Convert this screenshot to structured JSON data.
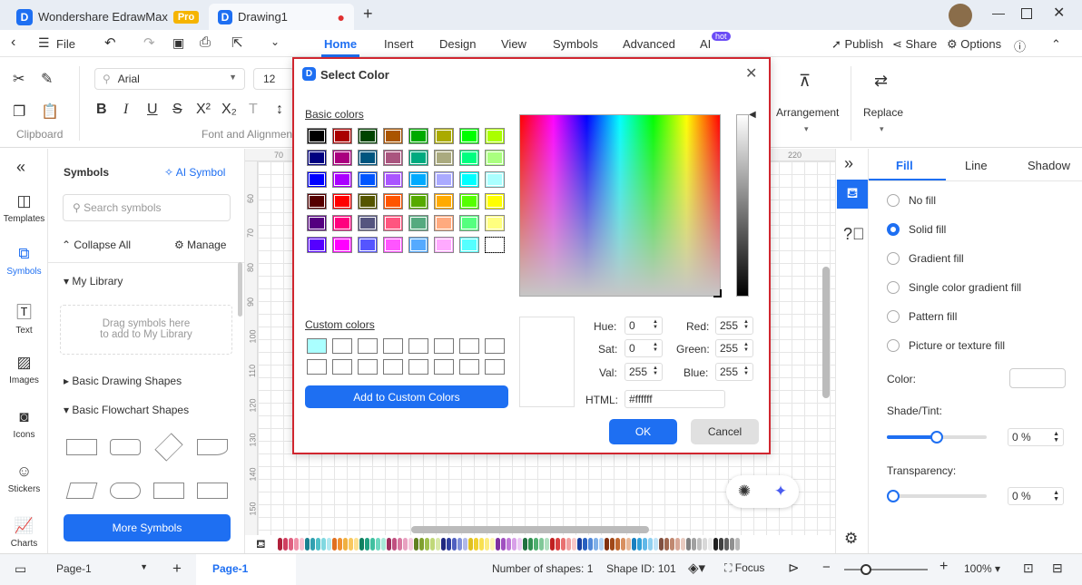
{
  "app": {
    "name": "Wondershare EdrawMax",
    "badge": "Pro",
    "doc_tab": "Drawing1"
  },
  "menu": {
    "file": "File",
    "tabs": [
      "Home",
      "Insert",
      "Design",
      "View",
      "Symbols",
      "Advanced",
      "AI"
    ],
    "ai_badge": "hot",
    "publish": "Publish",
    "share": "Share",
    "options": "Options"
  },
  "ribbon": {
    "font": "Arial",
    "size": "12",
    "clipboard": "Clipboard",
    "font_group": "Font and Alignment",
    "arrangement": "Arrangement",
    "replace": "Replace"
  },
  "leftbar": [
    "Templates",
    "Symbols",
    "Text",
    "Images",
    "Icons",
    "Stickers",
    "Charts"
  ],
  "symbols": {
    "title": "Symbols",
    "ai": "AI Symbol",
    "search_placeholder": "Search symbols",
    "collapse": "Collapse All",
    "manage": "Manage",
    "my_library": "My Library",
    "drop_hint": "Drag symbols here\nto add to My Library",
    "basic_drawing": "Basic Drawing Shapes",
    "basic_flowchart": "Basic Flowchart Shapes",
    "more": "More Symbols"
  },
  "ruler": {
    "top_first": "70",
    "top_last": "220",
    "left": [
      "60",
      "70",
      "80",
      "90",
      "100",
      "110",
      "120",
      "130",
      "140",
      "150"
    ]
  },
  "dialog": {
    "title": "Select Color",
    "basic_label": "Basic colors",
    "custom_label": "Custom colors",
    "add_custom": "Add to Custom Colors",
    "basic_colors": [
      "#000000",
      "#aa0000",
      "#004400",
      "#aa5500",
      "#00aa00",
      "#aaaa00",
      "#00ff00",
      "#aaff00",
      "#000080",
      "#aa007f",
      "#00557f",
      "#aa557f",
      "#00aa7f",
      "#aaaa7f",
      "#00ff7f",
      "#aaff7f",
      "#0000ff",
      "#aa00ff",
      "#0055ff",
      "#aa55ff",
      "#00aaff",
      "#aaaaff",
      "#00ffff",
      "#aaffff",
      "#550000",
      "#ff0000",
      "#555500",
      "#ff5500",
      "#55aa00",
      "#ffaa00",
      "#55ff00",
      "#ffff00",
      "#550080",
      "#ff007f",
      "#55557f",
      "#ff557f",
      "#55aa7f",
      "#ffaa7f",
      "#55ff7f",
      "#ffff7f",
      "#5500ff",
      "#ff00ff",
      "#5555ff",
      "#ff55ff",
      "#55aaff",
      "#ffaaff",
      "#55ffff",
      "#ffffff"
    ],
    "custom_colors": [
      "#aaffff",
      "#ffffff",
      "#ffffff",
      "#ffffff",
      "#ffffff",
      "#ffffff",
      "#ffffff",
      "#ffffff",
      "#ffffff",
      "#ffffff",
      "#ffffff",
      "#ffffff",
      "#ffffff",
      "#ffffff",
      "#ffffff",
      "#ffffff"
    ],
    "hue_label": "Hue:",
    "hue": "0",
    "sat_label": "Sat:",
    "sat": "0",
    "val_label": "Val:",
    "val": "255",
    "red_label": "Red:",
    "red": "255",
    "green_label": "Green:",
    "green": "255",
    "blue_label": "Blue:",
    "blue": "255",
    "html_label": "HTML:",
    "html": "#ffffff",
    "ok": "OK",
    "cancel": "Cancel"
  },
  "rightpanel": {
    "tabs": [
      "Fill",
      "Line",
      "Shadow"
    ],
    "options": [
      "No fill",
      "Solid fill",
      "Gradient fill",
      "Single color gradient fill",
      "Pattern fill",
      "Picture or texture fill"
    ],
    "selected": 1,
    "color_label": "Color:",
    "shade_label": "Shade/Tint:",
    "shade_value": "0 %",
    "shade_level": 0.5,
    "transparency_label": "Transparency:",
    "transparency_value": "0 %"
  },
  "status": {
    "page_select": "Page-1",
    "page_tab": "Page-1",
    "shapes": "Number of shapes: 1",
    "shape_id": "Shape ID: 101",
    "focus": "Focus",
    "zoom": "100%"
  },
  "palette": [
    "#b0203a",
    "#d04060",
    "#e06080",
    "#f090a8",
    "#f8c0d0",
    "#1a8090",
    "#30a0b0",
    "#50c0c8",
    "#80d8e0",
    "#b0e8f0",
    "#e07020",
    "#f09030",
    "#f0b040",
    "#f8c860",
    "#fde090",
    "#108060",
    "#20a080",
    "#40c0a0",
    "#70d8c0",
    "#a8e8d8",
    "#a03060",
    "#c05080",
    "#d878a0",
    "#e8a0c0",
    "#f4c8dc",
    "#608020",
    "#80a030",
    "#a0c050",
    "#c0d878",
    "#d8e8a8",
    "#202880",
    "#3040a0",
    "#5060c0",
    "#8090d8",
    "#b0b8e8",
    "#e0c020",
    "#f0d030",
    "#f8e050",
    "#fcec80",
    "#fdf4b0",
    "#8030a0",
    "#a050c0",
    "#c078d8",
    "#d8a0e8",
    "#ecc8f4",
    "#207040",
    "#309050",
    "#50b070",
    "#80c898",
    "#b0e0c0",
    "#c02020",
    "#d84040",
    "#e87070",
    "#f0a0a0",
    "#f8c8c8",
    "#1840a0",
    "#2860c0",
    "#5088d8",
    "#80b0e8",
    "#b0d0f4",
    "#803010",
    "#a04818",
    "#c06830",
    "#d89060",
    "#e8b898",
    "#1880c0",
    "#30a0d8",
    "#60b8e8",
    "#90d0f0",
    "#c0e4f8",
    "#805040",
    "#a06850",
    "#c08870",
    "#d8a898",
    "#e8cbc0",
    "#808080",
    "#a0a0a0",
    "#c0c0c0",
    "#d8d8d8",
    "#ececec",
    "#202020",
    "#404040",
    "#606060",
    "#909090",
    "#b8b8b8"
  ]
}
